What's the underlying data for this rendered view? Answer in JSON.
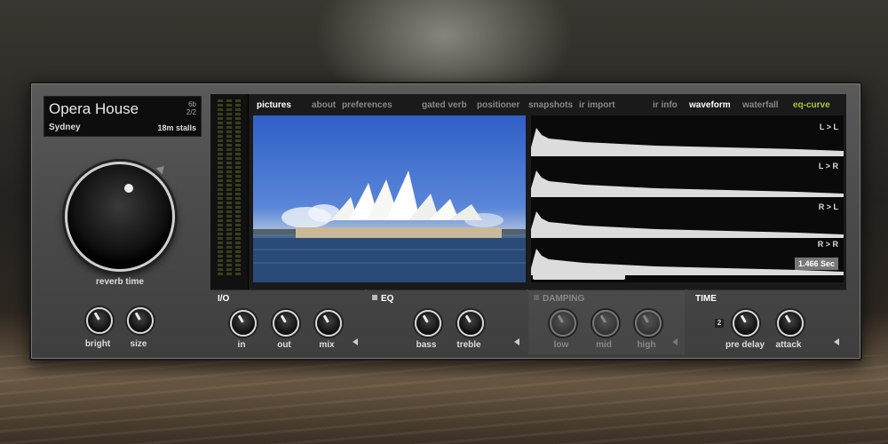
{
  "preset": {
    "name": "Opera House",
    "count_top": "6b",
    "count_bottom": "2/2",
    "location": "Sydney",
    "position": "18m stalls"
  },
  "main_knob": {
    "label": "reverb time"
  },
  "left_knobs": [
    {
      "label": "bright"
    },
    {
      "label": "size"
    }
  ],
  "tabs": [
    {
      "label": "pictures",
      "state": "active"
    },
    {
      "label": "about",
      "state": "inactive"
    },
    {
      "label": "preferences",
      "state": "inactive"
    },
    {
      "label": "gated verb",
      "state": "inactive"
    },
    {
      "label": "positioner",
      "state": "inactive"
    },
    {
      "label": "snapshots",
      "state": "inactive"
    },
    {
      "label": "ir import",
      "state": "inactive"
    },
    {
      "label": "ir info",
      "state": "inactive"
    },
    {
      "label": "waveform",
      "state": "active"
    },
    {
      "label": "waterfall",
      "state": "inactive"
    },
    {
      "label": "eq-curve",
      "state": "highlight"
    }
  ],
  "waveform": {
    "channels": [
      "L > L",
      "L > R",
      "R > L",
      "R > R"
    ],
    "duration": "1.466 Sec"
  },
  "sections": {
    "io": {
      "title": "I/O",
      "knobs": [
        "in",
        "out",
        "mix"
      ]
    },
    "eq": {
      "title": "EQ",
      "knobs": [
        "bass",
        "treble"
      ]
    },
    "damping": {
      "title": "DAMPING",
      "knobs": [
        "low",
        "mid",
        "high"
      ]
    },
    "time": {
      "title": "TIME",
      "knobs": [
        "pre delay",
        "attack"
      ],
      "badge": "2"
    }
  },
  "colors": {
    "accent_green": "#a8c830",
    "panel": "#4a4a4a",
    "screen": "#1a1a1a"
  }
}
